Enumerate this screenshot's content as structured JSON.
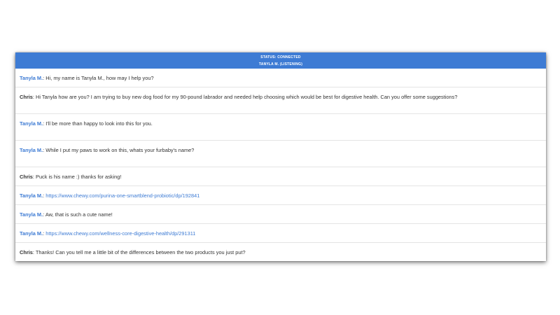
{
  "header": {
    "status": "STATUS: CONNECTED",
    "agent": "TANYLA M. (LISTENING)"
  },
  "messages": [
    {
      "sender": "Tanyla M.",
      "role": "agent",
      "text": "Hi, my name is Tanyla M., how may I help you?"
    },
    {
      "sender": "Chris",
      "role": "user",
      "text": "Hi Tanyla how are you? I am trying to buy new dog food for my 90-pound labrador and needed help choosing which would be best for digestive health. Can you offer some suggestions?"
    },
    {
      "sender": "Tanyla M.",
      "role": "agent",
      "text": "I'll be more than happy to look into this for you."
    },
    {
      "sender": "Tanyla M.",
      "role": "agent",
      "text": "While I put my paws to work on this, whats your furbaby's name?"
    },
    {
      "sender": "Chris",
      "role": "user",
      "text": "Puck is his name :) thanks for asking!"
    },
    {
      "sender": "Tanyla M.",
      "role": "agent",
      "link": "https://www.chewy.com/purina-one-smartblend-probiotic/dp/192841"
    },
    {
      "sender": "Tanyla M.",
      "role": "agent",
      "text": "Aw, that is such a cute name!"
    },
    {
      "sender": "Tanyla M.",
      "role": "agent",
      "link": "https://www.chewy.com/wellness-core-digestive-health/dp/291311"
    },
    {
      "sender": "Chris",
      "role": "user",
      "text": "Thanks! Can you tell me a little bit of the differences between the two products you just put?"
    }
  ],
  "colors": {
    "header_bg": "#3d7bd4",
    "agent_name": "#3d7bd4",
    "link": "#3d7bd4"
  }
}
